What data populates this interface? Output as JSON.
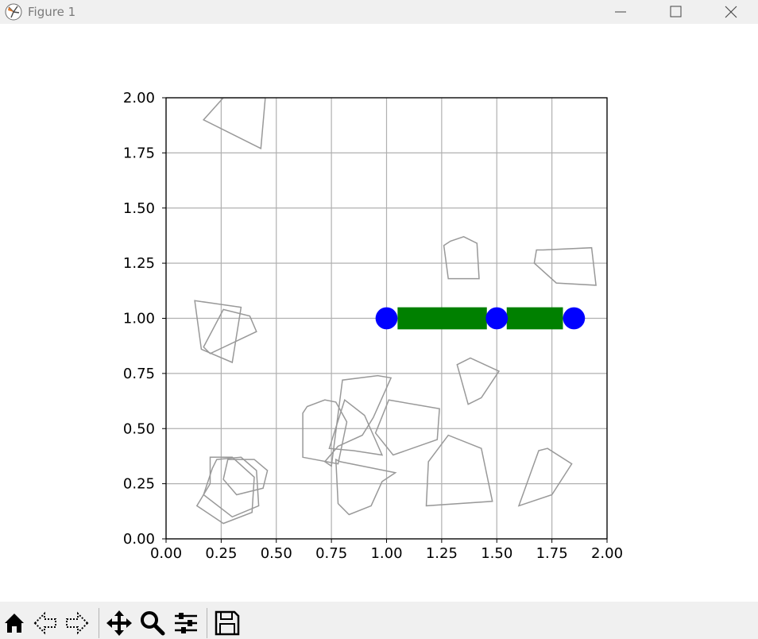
{
  "window": {
    "title": "Figure 1"
  },
  "toolbar": {
    "buttons": [
      {
        "name": "home-icon"
      },
      {
        "name": "back-arrow-icon"
      },
      {
        "name": "forward-arrow-icon"
      },
      {
        "name": "pan-move-icon"
      },
      {
        "name": "zoom-magnifier-icon"
      },
      {
        "name": "configure-subplots-icon"
      },
      {
        "name": "save-floppy-icon"
      }
    ]
  },
  "colors": {
    "links": "#008000",
    "joints": "#0000ff",
    "obstacles": "#999999",
    "grid": "#b0b0b0"
  },
  "chart_data": {
    "type": "scatter",
    "xlim": [
      0,
      2
    ],
    "ylim": [
      0,
      2
    ],
    "xticks": [
      "0.00",
      "0.25",
      "0.50",
      "0.75",
      "1.00",
      "1.25",
      "1.50",
      "1.75",
      "2.00"
    ],
    "yticks": [
      "0.00",
      "0.25",
      "0.50",
      "0.75",
      "1.00",
      "1.25",
      "1.50",
      "1.75",
      "2.00"
    ],
    "grid": true,
    "aspect": "equal",
    "joints": [
      [
        1.0,
        1.0
      ],
      [
        1.5,
        1.0
      ],
      [
        1.85,
        1.0
      ]
    ],
    "links": [
      {
        "x0": 1.05,
        "x1": 1.455,
        "y": 1.0,
        "width": 0.1
      },
      {
        "x0": 1.545,
        "x1": 1.8,
        "y": 1.0,
        "width": 0.1
      }
    ],
    "obstacles": [
      [
        [
          0.17,
          1.9
        ],
        [
          0.26,
          2.0
        ],
        [
          0.45,
          2.0
        ],
        [
          0.43,
          1.77
        ]
      ],
      [
        [
          0.16,
          0.86
        ],
        [
          0.13,
          1.08
        ],
        [
          0.34,
          1.05
        ],
        [
          0.3,
          0.8
        ]
      ],
      [
        [
          0.17,
          0.87
        ],
        [
          0.26,
          1.04
        ],
        [
          0.38,
          1.01
        ],
        [
          0.41,
          0.94
        ],
        [
          0.2,
          0.84
        ]
      ],
      [
        [
          0.2,
          0.25
        ],
        [
          0.2,
          0.37
        ],
        [
          0.3,
          0.37
        ],
        [
          0.4,
          0.28
        ],
        [
          0.39,
          0.12
        ],
        [
          0.26,
          0.07
        ],
        [
          0.14,
          0.15
        ]
      ],
      [
        [
          0.21,
          0.32
        ],
        [
          0.23,
          0.36
        ],
        [
          0.34,
          0.37
        ],
        [
          0.41,
          0.31
        ],
        [
          0.42,
          0.15
        ],
        [
          0.3,
          0.1
        ],
        [
          0.17,
          0.2
        ]
      ],
      [
        [
          0.26,
          0.27
        ],
        [
          0.28,
          0.36
        ],
        [
          0.4,
          0.36
        ],
        [
          0.46,
          0.31
        ],
        [
          0.44,
          0.23
        ],
        [
          0.32,
          0.2
        ]
      ],
      [
        [
          0.62,
          0.57
        ],
        [
          0.64,
          0.6
        ],
        [
          0.72,
          0.63
        ],
        [
          0.77,
          0.62
        ],
        [
          0.82,
          0.53
        ],
        [
          0.78,
          0.34
        ],
        [
          0.62,
          0.37
        ]
      ],
      [
        [
          0.74,
          0.41
        ],
        [
          0.81,
          0.63
        ],
        [
          0.9,
          0.56
        ],
        [
          0.98,
          0.38
        ],
        [
          0.85,
          0.4
        ]
      ],
      [
        [
          0.72,
          0.35
        ],
        [
          0.75,
          0.33
        ],
        [
          0.8,
          0.72
        ],
        [
          0.96,
          0.74
        ],
        [
          1.02,
          0.73
        ],
        [
          0.94,
          0.55
        ],
        [
          0.89,
          0.47
        ],
        [
          0.78,
          0.42
        ]
      ],
      [
        [
          0.77,
          0.36
        ],
        [
          0.78,
          0.16
        ],
        [
          0.83,
          0.11
        ],
        [
          0.93,
          0.15
        ],
        [
          0.98,
          0.26
        ],
        [
          1.04,
          0.3
        ],
        [
          0.79,
          0.35
        ]
      ],
      [
        [
          0.95,
          0.48
        ],
        [
          1.01,
          0.63
        ],
        [
          1.24,
          0.59
        ],
        [
          1.23,
          0.45
        ],
        [
          1.03,
          0.38
        ]
      ],
      [
        [
          1.18,
          0.15
        ],
        [
          1.19,
          0.35
        ],
        [
          1.28,
          0.47
        ],
        [
          1.43,
          0.41
        ],
        [
          1.48,
          0.17
        ]
      ],
      [
        [
          1.32,
          0.79
        ],
        [
          1.38,
          0.82
        ],
        [
          1.51,
          0.76
        ],
        [
          1.43,
          0.64
        ],
        [
          1.37,
          0.61
        ]
      ],
      [
        [
          1.26,
          1.33
        ],
        [
          1.29,
          1.35
        ],
        [
          1.35,
          1.37
        ],
        [
          1.41,
          1.34
        ],
        [
          1.42,
          1.18
        ],
        [
          1.28,
          1.18
        ]
      ],
      [
        [
          1.68,
          1.31
        ],
        [
          1.71,
          1.31
        ],
        [
          1.93,
          1.32
        ],
        [
          1.95,
          1.15
        ],
        [
          1.77,
          1.16
        ],
        [
          1.67,
          1.25
        ]
      ],
      [
        [
          1.6,
          0.15
        ],
        [
          1.69,
          0.4
        ],
        [
          1.73,
          0.41
        ],
        [
          1.84,
          0.34
        ],
        [
          1.75,
          0.2
        ]
      ]
    ]
  }
}
